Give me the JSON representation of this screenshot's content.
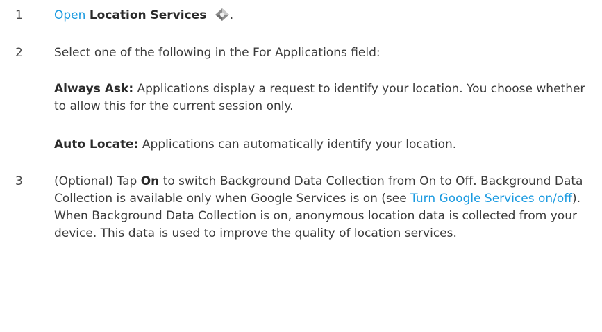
{
  "steps": [
    {
      "number": "1",
      "open_link": "Open",
      "app_name": "Location Services",
      "icon": "location-services-icon",
      "trailing": "."
    },
    {
      "number": "2",
      "text": "Select one of the following in the For Applications field:",
      "options": [
        {
          "label": "Always Ask:",
          "text": "Applications display a request to identify your location. You choose whether to allow this for the current session only."
        },
        {
          "label": "Auto Locate:",
          "text": "Applications can automatically identify your location."
        }
      ]
    },
    {
      "number": "3",
      "prefix": "(Optional) Tap",
      "tap_label": "On",
      "text_a": "to switch Background Data Collection from On to Off. Background Data Collection is available only when Google Services is on (see",
      "link": "Turn Google Services on/off",
      "text_b": "). When Background Data Collection is on, anonymous location data is collected from your device. This data is used to improve the quality of location services."
    }
  ],
  "colors": {
    "link": "#1a9ae0",
    "text": "#3b3b3b",
    "bold": "#2a2a2a"
  }
}
